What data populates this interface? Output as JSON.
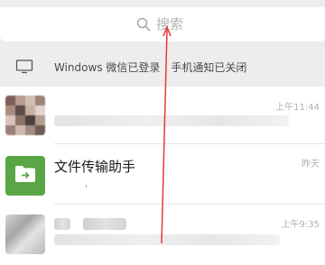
{
  "search": {
    "placeholder": "搜索",
    "icon": "search-icon"
  },
  "device_status": {
    "icon": "monitor-icon",
    "login_text": "Windows 微信已登录",
    "notify_text": "手机通知已关闭"
  },
  "chats": [
    {
      "name": "",
      "time": "上午11:44",
      "preview": ""
    },
    {
      "name": "文件传输助手",
      "time": "昨天",
      "preview": ","
    },
    {
      "name": "",
      "time": "上午9:35",
      "preview": ""
    }
  ],
  "colors": {
    "background": "#ededed",
    "file_helper_green": "#5aa647",
    "annotation_arrow": "#e53935"
  }
}
